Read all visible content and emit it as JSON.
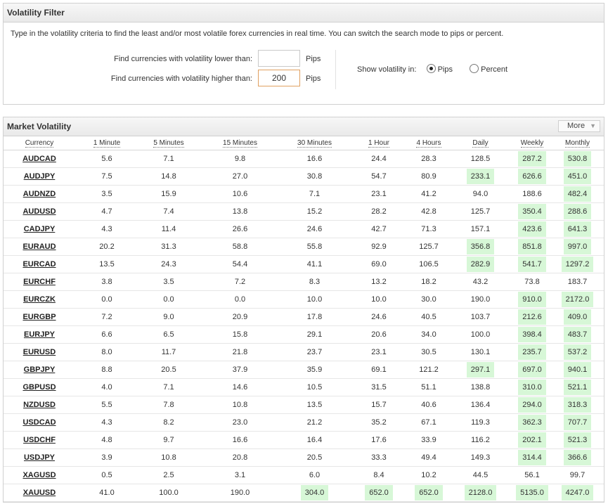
{
  "filter": {
    "title": "Volatility Filter",
    "description": "Type in the volatility criteria to find the least and/or most volatile forex currencies in real time. You can switch the search mode to pips or percent.",
    "lower_label": "Find currencies with volatility lower than:",
    "lower_value": "",
    "lower_unit": "Pips",
    "higher_label": "Find currencies with volatility higher than:",
    "higher_value": "200",
    "higher_unit": "Pips",
    "mode_label": "Show volatility in:",
    "mode_options": [
      "Pips",
      "Percent"
    ],
    "mode_selected": "Pips"
  },
  "market": {
    "title": "Market Volatility",
    "more_label": "More",
    "columns": [
      "Currency",
      "1 Minute",
      "5 Minutes",
      "15 Minutes",
      "30 Minutes",
      "1 Hour",
      "4 Hours",
      "Daily",
      "Weekly",
      "Monthly"
    ],
    "highlight_color": "#d7f7d7",
    "rows": [
      {
        "pair": "AUDCAD",
        "values": [
          "5.6",
          "7.1",
          "9.8",
          "16.6",
          "24.4",
          "28.3",
          "128.5",
          "287.2",
          "530.8"
        ],
        "hl": [
          7,
          8
        ]
      },
      {
        "pair": "AUDJPY",
        "values": [
          "7.5",
          "14.8",
          "27.0",
          "30.8",
          "54.7",
          "80.9",
          "233.1",
          "626.6",
          "451.0"
        ],
        "hl": [
          6,
          7,
          8
        ]
      },
      {
        "pair": "AUDNZD",
        "values": [
          "3.5",
          "15.9",
          "10.6",
          "7.1",
          "23.1",
          "41.2",
          "94.0",
          "188.6",
          "482.4"
        ],
        "hl": [
          8
        ]
      },
      {
        "pair": "AUDUSD",
        "values": [
          "4.7",
          "7.4",
          "13.8",
          "15.2",
          "28.2",
          "42.8",
          "125.7",
          "350.4",
          "288.6"
        ],
        "hl": [
          7,
          8
        ]
      },
      {
        "pair": "CADJPY",
        "values": [
          "4.3",
          "11.4",
          "26.6",
          "24.6",
          "42.7",
          "71.3",
          "157.1",
          "423.6",
          "641.3"
        ],
        "hl": [
          7,
          8
        ]
      },
      {
        "pair": "EURAUD",
        "values": [
          "20.2",
          "31.3",
          "58.8",
          "55.8",
          "92.9",
          "125.7",
          "356.8",
          "851.8",
          "997.0"
        ],
        "hl": [
          6,
          7,
          8
        ]
      },
      {
        "pair": "EURCAD",
        "values": [
          "13.5",
          "24.3",
          "54.4",
          "41.1",
          "69.0",
          "106.5",
          "282.9",
          "541.7",
          "1297.2"
        ],
        "hl": [
          6,
          7,
          8
        ]
      },
      {
        "pair": "EURCHF",
        "values": [
          "3.8",
          "3.5",
          "7.2",
          "8.3",
          "13.2",
          "18.2",
          "43.2",
          "73.8",
          "183.7"
        ],
        "hl": []
      },
      {
        "pair": "EURCZK",
        "values": [
          "0.0",
          "0.0",
          "0.0",
          "10.0",
          "10.0",
          "30.0",
          "190.0",
          "910.0",
          "2172.0"
        ],
        "hl": [
          7,
          8
        ]
      },
      {
        "pair": "EURGBP",
        "values": [
          "7.2",
          "9.0",
          "20.9",
          "17.8",
          "24.6",
          "40.5",
          "103.7",
          "212.6",
          "409.0"
        ],
        "hl": [
          7,
          8
        ]
      },
      {
        "pair": "EURJPY",
        "values": [
          "6.6",
          "6.5",
          "15.8",
          "29.1",
          "20.6",
          "34.0",
          "100.0",
          "398.4",
          "483.7"
        ],
        "hl": [
          7,
          8
        ]
      },
      {
        "pair": "EURUSD",
        "values": [
          "8.0",
          "11.7",
          "21.8",
          "23.7",
          "23.1",
          "30.5",
          "130.1",
          "235.7",
          "537.2"
        ],
        "hl": [
          7,
          8
        ]
      },
      {
        "pair": "GBPJPY",
        "values": [
          "8.8",
          "20.5",
          "37.9",
          "35.9",
          "69.1",
          "121.2",
          "297.1",
          "697.0",
          "940.1"
        ],
        "hl": [
          6,
          7,
          8
        ]
      },
      {
        "pair": "GBPUSD",
        "values": [
          "4.0",
          "7.1",
          "14.6",
          "10.5",
          "31.5",
          "51.1",
          "138.8",
          "310.0",
          "521.1"
        ],
        "hl": [
          7,
          8
        ]
      },
      {
        "pair": "NZDUSD",
        "values": [
          "5.5",
          "7.8",
          "10.8",
          "13.5",
          "15.7",
          "40.6",
          "136.4",
          "294.0",
          "318.3"
        ],
        "hl": [
          7,
          8
        ]
      },
      {
        "pair": "USDCAD",
        "values": [
          "4.3",
          "8.2",
          "23.0",
          "21.2",
          "35.2",
          "67.1",
          "119.3",
          "362.3",
          "707.7"
        ],
        "hl": [
          7,
          8
        ]
      },
      {
        "pair": "USDCHF",
        "values": [
          "4.8",
          "9.7",
          "16.6",
          "16.4",
          "17.6",
          "33.9",
          "116.2",
          "202.1",
          "521.3"
        ],
        "hl": [
          7,
          8
        ]
      },
      {
        "pair": "USDJPY",
        "values": [
          "3.9",
          "10.8",
          "20.8",
          "20.5",
          "33.3",
          "49.4",
          "149.3",
          "314.4",
          "366.6"
        ],
        "hl": [
          7,
          8
        ]
      },
      {
        "pair": "XAGUSD",
        "values": [
          "0.5",
          "2.5",
          "3.1",
          "6.0",
          "8.4",
          "10.2",
          "44.5",
          "56.1",
          "99.7"
        ],
        "hl": []
      },
      {
        "pair": "XAUUSD",
        "values": [
          "41.0",
          "100.0",
          "190.0",
          "304.0",
          "652.0",
          "652.0",
          "2128.0",
          "5135.0",
          "4247.0"
        ],
        "hl": [
          3,
          4,
          5,
          6,
          7,
          8
        ]
      }
    ]
  }
}
